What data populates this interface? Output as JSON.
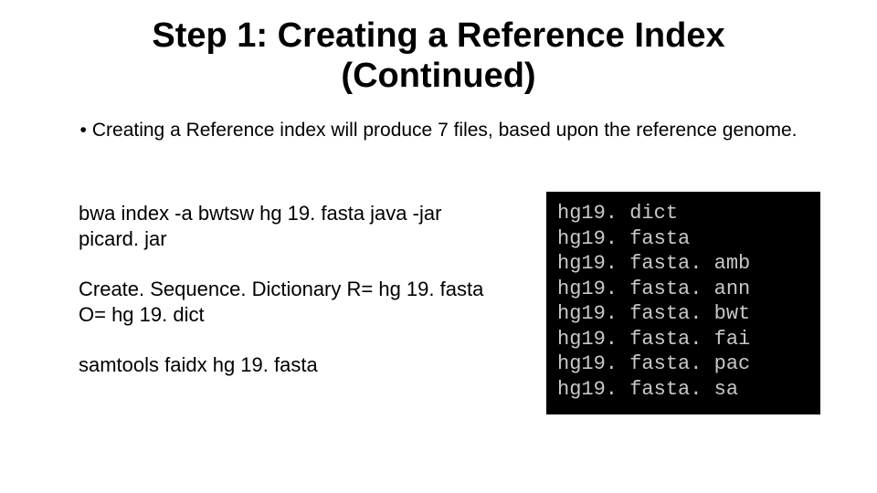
{
  "title_line1": "Step 1: Creating a Reference Index",
  "title_line2": "(Continued)",
  "bullet_text": "Creating a Reference index will produce  7 files, based upon the reference genome.",
  "commands": {
    "cmd1": "bwa index -a bwtsw hg 19. fasta java -jar picard. jar",
    "cmd2": "Create. Sequence. Dictionary R= hg 19. fasta O= hg 19. dict",
    "cmd3": "samtools faidx hg 19. fasta"
  },
  "terminal_lines": [
    "hg19. dict",
    "hg19. fasta",
    "hg19. fasta. amb",
    "hg19. fasta. ann",
    "hg19. fasta. bwt",
    "hg19. fasta. fai",
    "hg19. fasta. pac",
    "hg19. fasta. sa"
  ]
}
